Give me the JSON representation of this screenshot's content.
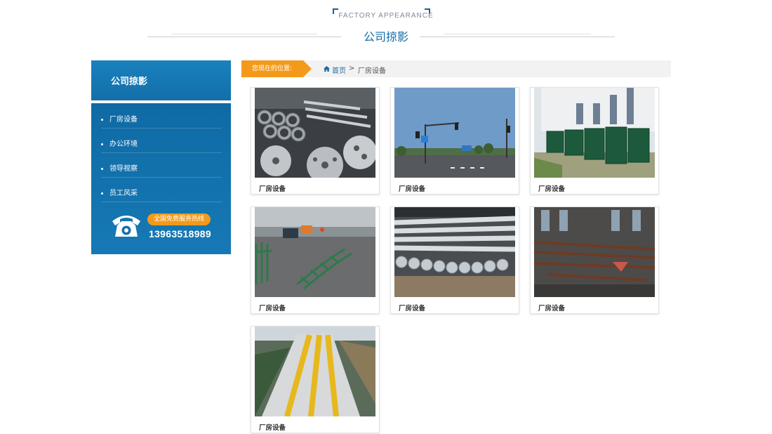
{
  "header": {
    "title_en": "FACTORY APPEARANCE",
    "title_cn": "公司掠影"
  },
  "sidebar": {
    "title": "公司掠影",
    "items": [
      {
        "label": "厂房设备"
      },
      {
        "label": "办公环境"
      },
      {
        "label": "领导视察"
      },
      {
        "label": "员工风采"
      }
    ],
    "hotline_label": "全国免费服务热线",
    "hotline_number": "13963518989"
  },
  "breadcrumb": {
    "prefix": "您现在的位置:",
    "home": "首页",
    "separator": ">",
    "current": "厂房设备"
  },
  "gallery": [
    {
      "caption": "厂房设备",
      "image": "steel-pipe-stacks-photo"
    },
    {
      "caption": "厂房设备",
      "image": "traffic-signal-road-photo"
    },
    {
      "caption": "厂房设备",
      "image": "green-fence-panels-photo"
    },
    {
      "caption": "厂房设备",
      "image": "road-guardrail-installation-photo"
    },
    {
      "caption": "厂房设备",
      "image": "galvanized-poles-photo"
    },
    {
      "caption": "厂房设备",
      "image": "workshop-steel-frames-photo"
    },
    {
      "caption": "厂房设备",
      "image": "yellow-guardrail-painting-photo"
    }
  ],
  "colors": {
    "brand_blue": "#136fa9",
    "accent_orange": "#f49a1a",
    "title_blue": "#126ba7"
  }
}
